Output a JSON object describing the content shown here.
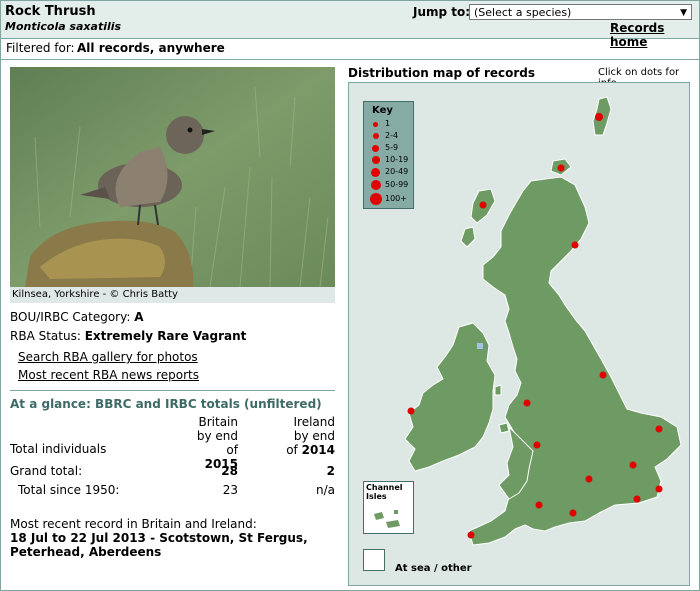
{
  "species": {
    "common_name": "Rock Thrush",
    "scientific_name": "Monticola saxatilis"
  },
  "header": {
    "jump_label": "Jump to:",
    "jump_select_value": "(Select a species)",
    "records_home": "Records home"
  },
  "filter": {
    "label": "Filtered for:",
    "value": "All records, anywhere"
  },
  "photo": {
    "caption": "Kilnsea, Yorkshire - © Chris Batty"
  },
  "status": {
    "category_label": "BOU/IRBC Category:",
    "category_value": "A",
    "rba_label": "RBA Status:",
    "rba_value": "Extremely Rare Vagrant"
  },
  "links": {
    "gallery": "Search RBA gallery for photos",
    "news": "Most recent RBA news reports"
  },
  "glance": {
    "title": "At a glance: BBRC and IRBC totals (unfiltered)",
    "britain_header": [
      "Britain",
      "by end",
      "of"
    ],
    "britain_year": "2015",
    "ireland_header": [
      "Ireland",
      "by end",
      "of"
    ],
    "ireland_year": "2014",
    "total_individuals_label": "Total individuals",
    "grand_total_label": "Grand total:",
    "grand_total_britain": "28",
    "grand_total_ireland": "2",
    "since_label": "Total since 1950:",
    "since_britain": "23",
    "since_ireland": "n/a"
  },
  "recent": {
    "label": "Most recent record in Britain and Ireland:",
    "line1": "18 Jul to 22 Jul 2013 - Scotstown, St Fergus,",
    "line2": "Peterhead, Aberdeens"
  },
  "map": {
    "title": "Distribution map of records",
    "hint": "Click on dots for info",
    "key_title": "Key",
    "key_items": [
      "1",
      "2-4",
      "5-9",
      "10-19",
      "20-49",
      "50-99",
      "100+"
    ],
    "channel_isles_label": [
      "Channel",
      "Isles"
    ],
    "at_sea_label": "At sea / other",
    "colors": {
      "land": "#6e9b63",
      "dot": "#e00000",
      "sea": "#dde8e5"
    }
  }
}
